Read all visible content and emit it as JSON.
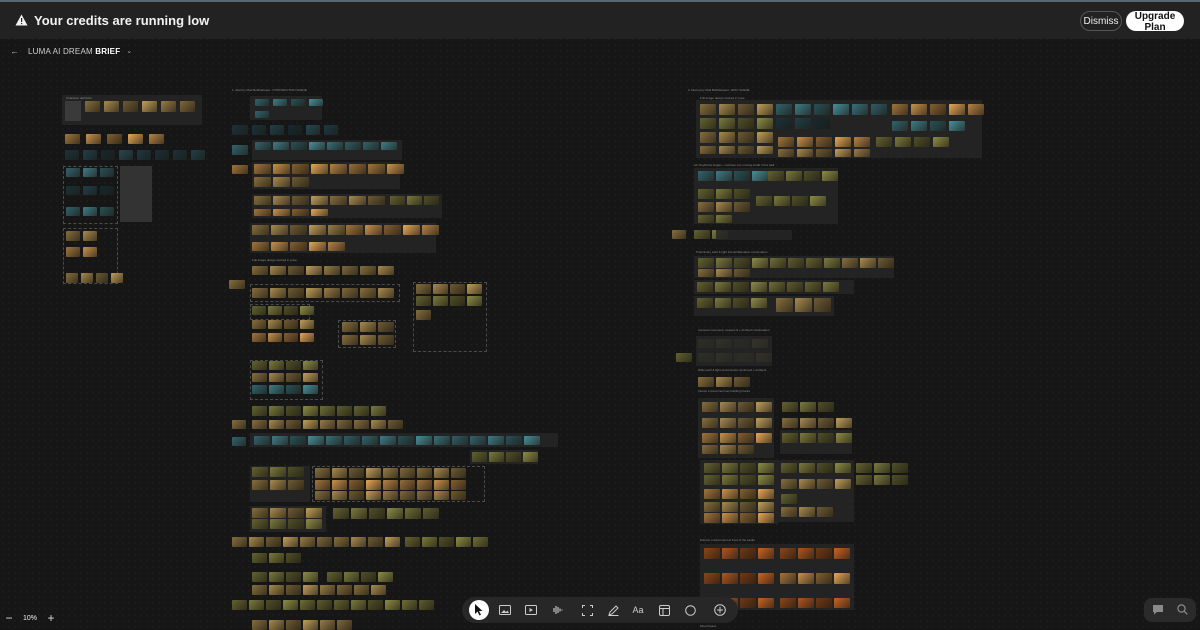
{
  "banner": {
    "message": "Your credits are running low",
    "dismiss_label": "Dismiss",
    "upgrade_label": "Upgrade Plan",
    "icon": "warning-icon"
  },
  "breadcrumb": {
    "back_icon": "arrow-left-icon",
    "board_name_prefix": "LUMA AI DREAM",
    "board_name_bold": "BRIEF",
    "dropdown_icon": "chevron-down-icon"
  },
  "canvas": {
    "section_labels": [
      "Character definition",
      "1. Start by Mud Bubblebeast - INTRODUCTION SCENE",
      "2. Discovery Mud Bubblebeast - EPIC SCENE",
      "Full-image design worked in pose",
      "Alt. Keyframe Angles - continue cut, moving small / hit a wall",
      "Preliminary swirl & light Interior/Elevation continuation",
      "Camera movement, sweeps & + Ambient continuation",
      "Wide swirl & light environment continued + Ambient",
      "Interior environment set building blocks",
      "Exterior environment at front of the castle",
      "Mood board"
    ],
    "palette": {
      "gold": "#a88a4e",
      "amber": "#c9924b",
      "teal": "#3d7c88",
      "dark_teal": "#1f3f4a",
      "olive": "#7a7a3c",
      "orange": "#b0561e"
    }
  },
  "zoom": {
    "level": "10%",
    "minus": "−",
    "plus": "+"
  },
  "toolbar": {
    "tools": [
      {
        "name": "select-tool",
        "icon": "cursor-icon",
        "active": true
      },
      {
        "name": "image-tool",
        "icon": "image-icon",
        "active": false
      },
      {
        "name": "video-tool",
        "icon": "video-icon",
        "active": false
      },
      {
        "name": "audio-tool",
        "icon": "waveform-icon",
        "active": false
      },
      {
        "name": "frame-tool",
        "icon": "frame-icon",
        "active": false
      },
      {
        "name": "draw-tool",
        "icon": "pen-icon",
        "active": false
      },
      {
        "name": "text-tool",
        "icon": "text-icon",
        "active": false
      },
      {
        "name": "board-tool",
        "icon": "board-icon",
        "active": false
      },
      {
        "name": "shape-tool",
        "icon": "circle-icon",
        "active": false
      },
      {
        "name": "add-tool",
        "icon": "plus-circle-icon",
        "active": false
      }
    ],
    "text_tool_glyph": "Aa"
  },
  "assist": {
    "chat_icon": "chat-icon",
    "search_icon": "search-icon"
  }
}
